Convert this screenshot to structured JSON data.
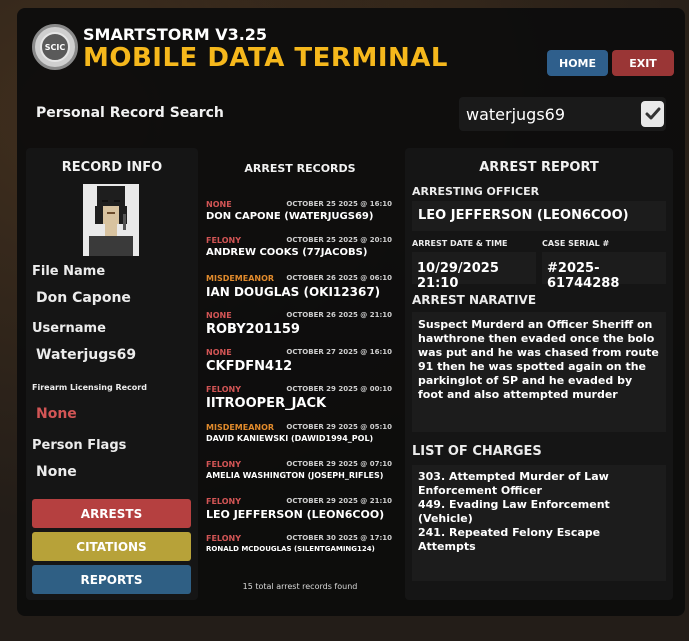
{
  "header": {
    "logo_text": "SCIC",
    "version": "SMARTSTORM V3.25",
    "title": "MOBILE DATA TERMINAL",
    "home_label": "HOME",
    "exit_label": "EXIT"
  },
  "search": {
    "label": "Personal Record Search",
    "value": "waterjugs69"
  },
  "record_info": {
    "title": "RECORD INFO",
    "file_name_label": "File Name",
    "file_name": "Don Capone",
    "username_label": "Username",
    "username": "Waterjugs69",
    "firearm_label": "Firearm Licensing Record",
    "firearm_value": "None",
    "flags_label": "Person Flags",
    "flags_value": "None",
    "arrests_btn": "ARRESTS",
    "citations_btn": "CITATIONS",
    "reports_btn": "REPORTS"
  },
  "arrest_records": {
    "title": "ARREST RECORDS",
    "items": [
      {
        "type": "NONE",
        "date": "OCTOBER 25 2025 @ 16:10",
        "name": "DON CAPONE (WATERJUGS69)"
      },
      {
        "type": "FELONY",
        "date": "OCTOBER 25 2025 @ 20:10",
        "name": "ANDREW COOKS (77JACOBS)"
      },
      {
        "type": "MISDEMEANOR",
        "date": "OCTOBER 26 2025 @ 06:10",
        "name": "IAN DOUGLAS (OKI12367)"
      },
      {
        "type": "NONE",
        "date": "OCTOBER 26 2025 @ 21:10",
        "name": "ROBY201159"
      },
      {
        "type": "NONE",
        "date": "OCTOBER 27 2025 @ 16:10",
        "name": "CKFDFN412"
      },
      {
        "type": "FELONY",
        "date": "OCTOBER 29 2025 @ 00:10",
        "name": "IITROOPER_JACK"
      },
      {
        "type": "MISDEMEANOR",
        "date": "OCTOBER 29 2025 @ 05:10",
        "name": "DAVID KANIEWSKI (DAWID1994_POL)"
      },
      {
        "type": "FELONY",
        "date": "OCTOBER 29 2025 @ 07:10",
        "name": "AMELIA WASHINGTON (JOSEPH_RIFLES)"
      },
      {
        "type": "FELONY",
        "date": "OCTOBER 29 2025 @ 21:10",
        "name": "LEO JEFFERSON (LEON6COO)"
      },
      {
        "type": "FELONY",
        "date": "OCTOBER 30 2025 @ 17:10",
        "name": "RONALD MCDOUGLAS (SILENTGAMING124)"
      }
    ],
    "total": "15 total arrest records found"
  },
  "arrest_report": {
    "title": "ARREST REPORT",
    "officer_label": "ARRESTING OFFICER",
    "officer": "LEO JEFFERSON (LEON6COO)",
    "date_label": "ARREST DATE & TIME",
    "date": "10/29/2025 21:10",
    "serial_label": "CASE SERIAL #",
    "serial": "#2025-61744288",
    "narrative_label": "ARREST NARATIVE",
    "narrative": "Suspect Murderd an Officer Sheriff on hawthrone then evaded once the bolo was put and he was chased from route 91 then he was spotted again on the parkinglot of SP and he evaded by foot and also attempted murder",
    "charges_label": "LIST OF CHARGES",
    "charges": " 303. Attempted Murder of Law Enforcement Officer\n449. Evading Law Enforcement (Vehicle)\n241. Repeated Felony Escape Attempts"
  },
  "colors": {
    "accent_yellow": "#f6b81c",
    "home_blue": "#2f5f8c",
    "exit_red": "#9a3636",
    "felony": "#d25555",
    "misdemeanor": "#e08a2c",
    "none": "#d25555"
  }
}
